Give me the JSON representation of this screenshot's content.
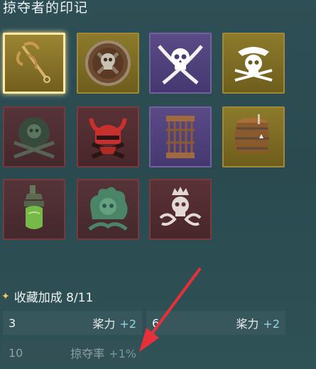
{
  "header": {
    "title": "掠夺者的印记"
  },
  "tiles": [
    {
      "icon": "grappling-hook-icon",
      "rarity": "gold",
      "selected": true
    },
    {
      "icon": "skull-shield-icon",
      "rarity": "gold"
    },
    {
      "icon": "skull-crossed-swords-icon",
      "rarity": "purple"
    },
    {
      "icon": "pirate-skull-hat-icon",
      "rarity": "gold"
    },
    {
      "icon": "jolly-roger-swords-icon",
      "rarity": "red"
    },
    {
      "icon": "horned-helmet-icon",
      "rarity": "red"
    },
    {
      "icon": "iron-cage-icon",
      "rarity": "purple"
    },
    {
      "icon": "barrel-icon",
      "rarity": "gold"
    },
    {
      "icon": "lantern-bottle-icon",
      "rarity": "red"
    },
    {
      "icon": "flaming-skull-icon",
      "rarity": "red"
    },
    {
      "icon": "crowned-skull-icon",
      "rarity": "red"
    }
  ],
  "bonus": {
    "label": "收藏加成 8/11",
    "rows": [
      {
        "threshold": "3",
        "stat": "桨力",
        "value": "+2"
      },
      {
        "threshold": "6",
        "stat": "桨力",
        "value": "+2"
      },
      {
        "threshold": "10",
        "stat": "掠夺率",
        "value": "+1%"
      }
    ]
  },
  "colors": {
    "accent_arrow": "#e8303a",
    "gold_border": "#ffe9a6",
    "bonus_value": "#8fd6e0"
  }
}
